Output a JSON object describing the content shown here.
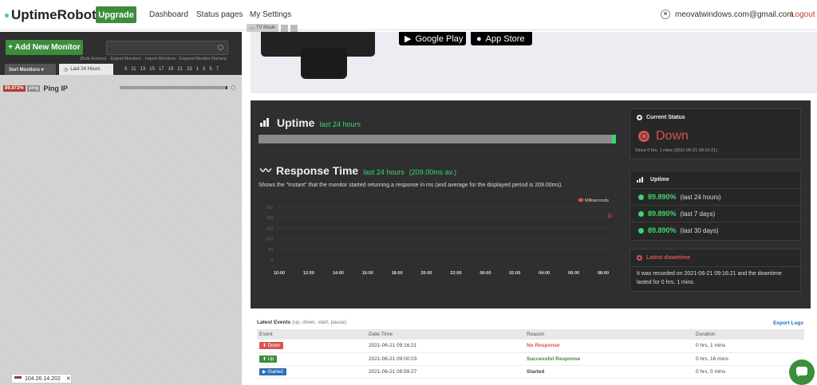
{
  "header": {
    "logo": "UptimeRobot",
    "upgrade": "Upgrade",
    "nav": [
      "Dashboard",
      "Status pages",
      "My Settings"
    ],
    "user_email": "meovatwindows.com@gmail.com",
    "logout": "Logout"
  },
  "toolbar": {
    "tv_mode": "TV Mode"
  },
  "sidebar": {
    "add_monitor": "+ Add New Monitor",
    "bulk_links": "(Bulk Actions) · Export Monitors · Import Monitors · Expand Monitor Names)",
    "sort": "Sort Monitors  ▾",
    "last24": "Last 24 Hours",
    "hours": [
      "9",
      "11",
      "13",
      "15",
      "17",
      "19",
      "21",
      "23",
      "1",
      "3",
      "5",
      "7"
    ],
    "monitor": {
      "pct": "89.972%",
      "type": "ping",
      "name": "Ping IP"
    },
    "ip": "104.26.14.202"
  },
  "app_banner": {
    "google_play": "Google Play",
    "app_store": "App Store"
  },
  "uptime": {
    "title": "Uptime",
    "sub": "last 24 hours",
    "ratio": 0.9899
  },
  "response": {
    "title": "Response Time",
    "sub": "last 24 hours",
    "avg": "(209.00ms av.)",
    "desc": "Shows the \"Instant\" that the monitor started returning a response in ms (and average for the displayed period is 209.00ms)."
  },
  "chart_data": {
    "type": "line",
    "legend": "Milliseconds",
    "x_ticks": [
      "10:00",
      "12:00",
      "14:00",
      "16:00",
      "18:00",
      "20:00",
      "22:00",
      "00:00",
      "02:00",
      "04:00",
      "06:00",
      "08:00"
    ],
    "y_ticks": [
      0,
      50,
      100,
      150,
      200,
      250
    ],
    "ylim": [
      0,
      250
    ],
    "series": [
      {
        "name": "Milliseconds",
        "points": [
          {
            "x": "09:16",
            "y": 209
          }
        ]
      }
    ]
  },
  "current_status": {
    "title": "Current Status",
    "status": "Down",
    "since": "Since 0 hrs, 1 mins (2021-06-21 09:16:21)"
  },
  "uptime_stats": {
    "title": "Uptime",
    "rows": [
      {
        "value": "89.890%",
        "period": "(last 24 hours)"
      },
      {
        "value": "89.890%",
        "period": "(last 7 days)"
      },
      {
        "value": "89.890%",
        "period": "(last 30 days)"
      }
    ]
  },
  "latest_downtime": {
    "title": "Latest downtime",
    "text": "It was recorded on 2021-06-21 09:16:21 and the downtime lasted for 0 hrs, 1 mins."
  },
  "events": {
    "title": "Latest Events",
    "sub": "(up, down, start, pause)",
    "export": "Export Logs",
    "columns": [
      "Event",
      "Date-Time",
      "Reason",
      "Duration"
    ],
    "rows": [
      {
        "event": "⬇ Down",
        "kind": "down",
        "datetime": "2021-06-21 09:16:21",
        "reason": "No Response",
        "reason_color": "#d9534f",
        "duration": "0 hrs, 1 mins"
      },
      {
        "event": "⬆ Up",
        "kind": "up",
        "datetime": "2021-06-21 09:00:03",
        "reason": "Successful Response",
        "reason_color": "#3c8d3c",
        "duration": "0 hrs, 16 mins"
      },
      {
        "event": "▶ Started",
        "kind": "started",
        "datetime": "2021-06-21 08:59:27",
        "reason": "Started",
        "reason_color": "#333",
        "duration": "0 hrs, 0 mins"
      }
    ]
  }
}
